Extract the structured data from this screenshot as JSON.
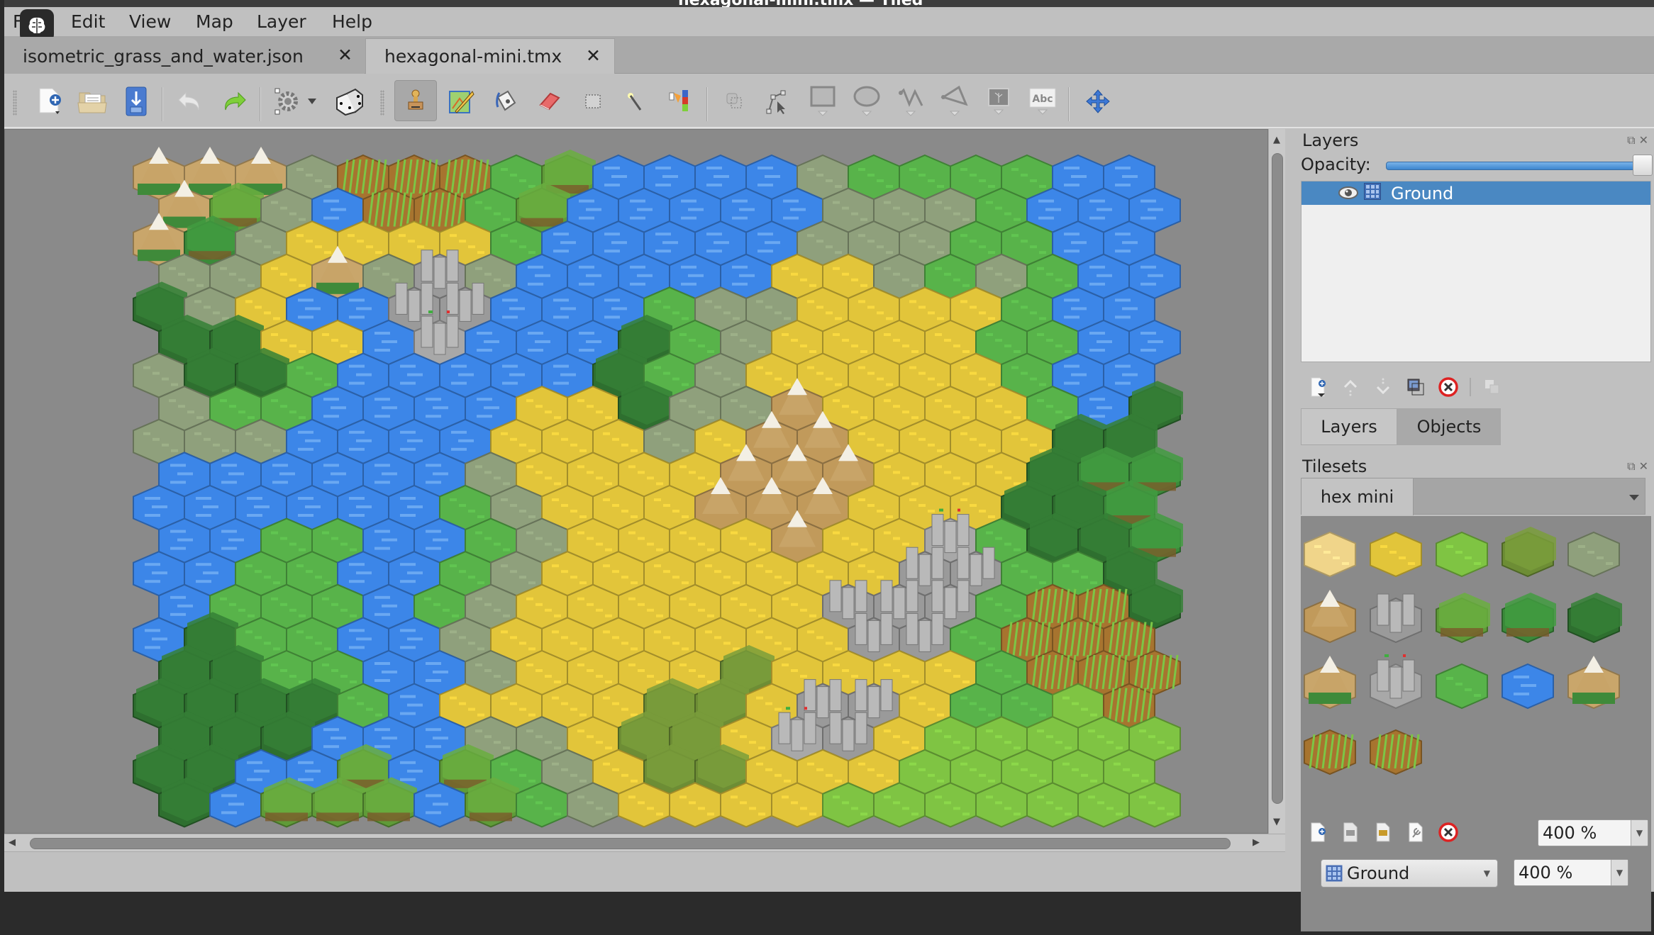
{
  "window": {
    "title": "hexagonal-mini.tmx — Tiled"
  },
  "menu": [
    "File",
    "Edit",
    "View",
    "Map",
    "Layer",
    "Help"
  ],
  "tabs": [
    {
      "label": "isometric_grass_and_water.json",
      "active": false
    },
    {
      "label": "hexagonal-mini.tmx",
      "active": true
    }
  ],
  "toolbar": {
    "file_tools": [
      "new-map",
      "open",
      "save"
    ],
    "history": [
      "undo",
      "redo"
    ],
    "map_tools": [
      "commands",
      "random-mode"
    ],
    "tile_tools": [
      "stamp-brush",
      "terrain-brush",
      "bucket-fill",
      "eraser",
      "rectangle-select",
      "magic-wand",
      "select-same-tile"
    ],
    "object_tools": [
      "select-objects",
      "edit-polygons",
      "insert-rectangle",
      "insert-ellipse",
      "insert-polyline",
      "insert-polygon",
      "insert-tile",
      "insert-text"
    ],
    "extra": [
      "move-tool"
    ],
    "active_tool": "stamp-brush"
  },
  "layers_panel": {
    "title": "Layers",
    "opacity_label": "Opacity:",
    "opacity_value": 1.0,
    "layers": [
      {
        "name": "Ground",
        "visible": true,
        "selected": true,
        "type": "tile-layer"
      }
    ],
    "tabs": [
      "Layers",
      "Objects"
    ],
    "active_tab": "Layers"
  },
  "tilesets_panel": {
    "title": "Tilesets",
    "active_tileset": "hex mini",
    "zoom": "400 %",
    "tiles": [
      "sand",
      "savanna",
      "grass-light",
      "olive-forest",
      "rocky-plain",
      "desert-mountain-snow",
      "grey-mountain",
      "grass-hill",
      "forest-hill",
      "pine-forest",
      "desert-mountain",
      "castle",
      "grass",
      "water",
      "snow-mountain-forest",
      "farm-green",
      "farm-orange"
    ]
  },
  "status": {
    "layer_combo": "Ground",
    "zoom": "400 %"
  },
  "terrain_colors": {
    "W": "#3c86e8",
    "Y": "#e2c53a",
    "G": "#8fa07c",
    "g": "#58b34a",
    "L": "#7fc443",
    "T": "#2e6f2f",
    "F": "#a7742f",
    "M": "#c9a66b",
    "m": "#c19a5b",
    "C": "#9a9a9a",
    "c": "#a8a8a8",
    "h": "#5f9b38",
    "d": "#3b8a3a",
    "o": "#6d8d35",
    "S": "#f0d58a"
  },
  "map": {
    "columns": 20,
    "rows": 20,
    "grid": [
      "MMMGFFFghWWWWGggggWW",
      "MhGWFFghWWWWWGGGgWWW",
      "MdGYYYYgWWWWWGGGggWW",
      "GGYMGCGWWWWWYYGgGgWW",
      "TGYWWCCWWWgGGYYYYgWW",
      "TTYYWcWWWTgGYYYYggWW",
      "GTTgWWWWWTgGYYYYYgWW",
      "GggWWWWYYTGGmYYYYgWT",
      "GGGWWWWYYYGYmmYYYYTT",
      "WWWWWWGYYYYmmmYYYTdd",
      "WWWWWWgGYYYmmmYYYTTd",
      "WWggWWgGYYYYmYYcgTTd",
      "WWggWWgGYYYYYYYCCggT",
      "WgggWgGYYYYYYCCCgFFT",
      "WTggWWGYYYYYYYCCgFFF",
      "TTggWWGYYYYoYYYYgFFF",
      "TTTTgWYYYYooYCCYggLF",
      "TTTWWWGGYooYcCYLLLLL",
      "TTWWhWhgGYooYYYLLLLL",
      "TWhhhWhgGYYYYLLLLLLL"
    ]
  }
}
